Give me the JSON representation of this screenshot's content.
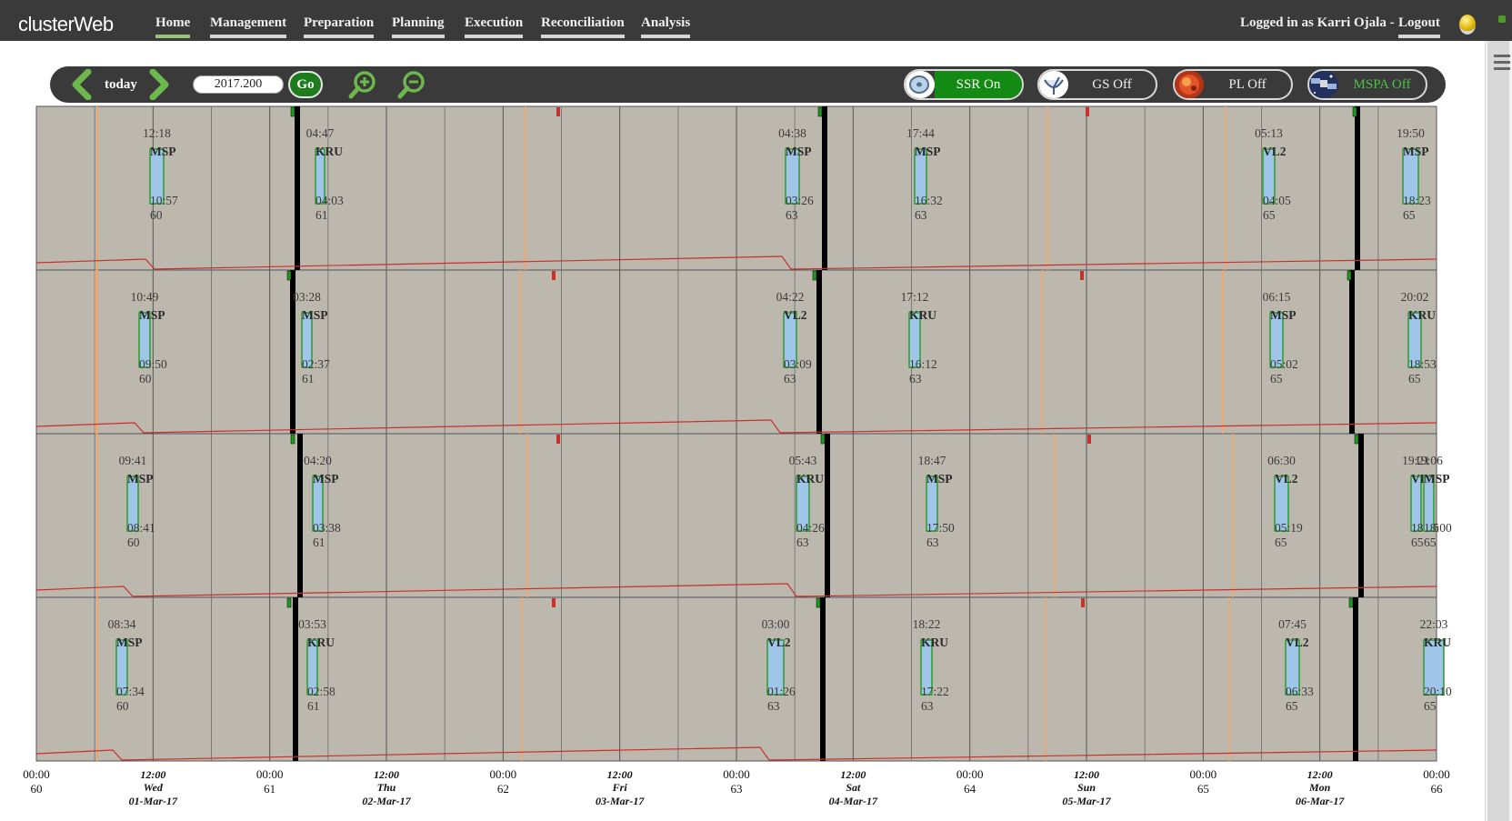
{
  "app": {
    "logo": "clusterWeb"
  },
  "nav": {
    "items": [
      {
        "label": "Home",
        "active": true
      },
      {
        "label": "Management"
      },
      {
        "label": "Preparation"
      },
      {
        "label": "Planning"
      },
      {
        "label": "Execution"
      },
      {
        "label": "Reconciliation"
      },
      {
        "label": "Analysis"
      }
    ],
    "user_label": "Logged in as Karri Ojala -",
    "logout_label": "Logout"
  },
  "toolbar": {
    "today_label": "today",
    "date_value": "2017.200",
    "go_label": "Go",
    "toggles": [
      {
        "label": "SSR On",
        "state": "on",
        "icon": "ssr-disk-icon"
      },
      {
        "label": "GS Off",
        "state": "off",
        "icon": "ground-station-dish-icon"
      },
      {
        "label": "PL Off",
        "state": "off",
        "icon": "payload-sun-icon"
      },
      {
        "label": "MSPA Off",
        "state": "off",
        "icon": "mspa-satellite-icon"
      }
    ]
  },
  "colors": {
    "nav_bg": "#3a3a3a",
    "plot_bg": "#bcb8ae",
    "pass_fill": "#9fc5e8",
    "pass_border": "#2e9a2e",
    "orange_marker": "#f2a56b",
    "red_curve": "#c9302c",
    "accent_green": "#138a13"
  },
  "axis": {
    "ticks": [
      {
        "time": "00:00",
        "sub": "60",
        "bold": false
      },
      {
        "time": "12:00",
        "day": "Wed",
        "date": "01-Mar-17",
        "bold": true
      },
      {
        "time": "00:00",
        "sub": "61",
        "bold": false
      },
      {
        "time": "12:00",
        "day": "Thu",
        "date": "02-Mar-17",
        "bold": true
      },
      {
        "time": "00:00",
        "sub": "62",
        "bold": false
      },
      {
        "time": "12:00",
        "day": "Fri",
        "date": "03-Mar-17",
        "bold": true
      },
      {
        "time": "00:00",
        "sub": "63",
        "bold": false
      },
      {
        "time": "12:00",
        "day": "Sat",
        "date": "04-Mar-17",
        "bold": true
      },
      {
        "time": "00:00",
        "sub": "64",
        "bold": false
      },
      {
        "time": "12:00",
        "day": "Sun",
        "date": "05-Mar-17",
        "bold": true
      },
      {
        "time": "00:00",
        "sub": "65",
        "bold": false
      },
      {
        "time": "12:00",
        "day": "Mon",
        "date": "06-Mar-17",
        "bold": true
      },
      {
        "time": "00:00",
        "sub": "66",
        "bold": false
      }
    ]
  },
  "rows": [
    {
      "passes": [
        {
          "start": "12:18",
          "station": "MSP",
          "end": "10:57",
          "orbit": "60"
        },
        {
          "start": "04:47",
          "station": "KRU",
          "end": "04:03",
          "orbit": "61"
        },
        {
          "start": "04:38",
          "station": "MSP",
          "end": "03:26",
          "orbit": "63"
        },
        {
          "start": "17:44",
          "station": "MSP",
          "end": "16:32",
          "orbit": "63"
        },
        {
          "start": "05:13",
          "station": "VL2",
          "end": "04:05",
          "orbit": "65"
        },
        {
          "start": "19:50",
          "station": "MSP",
          "end": "18:23",
          "orbit": "65"
        }
      ]
    },
    {
      "passes": [
        {
          "start": "10:49",
          "station": "MSP",
          "end": "09:50",
          "orbit": "60"
        },
        {
          "start": "03:28",
          "station": "MSP",
          "end": "02:37",
          "orbit": "61"
        },
        {
          "start": "04:22",
          "station": "VL2",
          "end": "03:09",
          "orbit": "63"
        },
        {
          "start": "17:12",
          "station": "KRU",
          "end": "16:12",
          "orbit": "63"
        },
        {
          "start": "06:15",
          "station": "MSP",
          "end": "05:02",
          "orbit": "65"
        },
        {
          "start": "20:02",
          "station": "KRU",
          "end": "18:53",
          "orbit": "65"
        }
      ]
    },
    {
      "passes": [
        {
          "start": "09:41",
          "station": "MSP",
          "end": "08:41",
          "orbit": "60"
        },
        {
          "start": "04:20",
          "station": "MSP",
          "end": "03:38",
          "orbit": "61"
        },
        {
          "start": "05:43",
          "station": "KRU",
          "end": "04:26",
          "orbit": "63"
        },
        {
          "start": "18:47",
          "station": "MSP",
          "end": "17:50",
          "orbit": "63"
        },
        {
          "start": "06:30",
          "station": "VL2",
          "end": "05:19",
          "orbit": "65"
        },
        {
          "start": "19:21",
          "station": "VL2",
          "end": "18:05",
          "orbit": "65"
        },
        {
          "start": "19:06",
          "station": "MSP",
          "end": "18:00",
          "orbit": "65"
        }
      ]
    },
    {
      "passes": [
        {
          "start": "08:34",
          "station": "MSP",
          "end": "07:34",
          "orbit": "60"
        },
        {
          "start": "03:53",
          "station": "KRU",
          "end": "02:58",
          "orbit": "61"
        },
        {
          "start": "03:00",
          "station": "VL2",
          "end": "01:26",
          "orbit": "63"
        },
        {
          "start": "18:22",
          "station": "KRU",
          "end": "17:22",
          "orbit": "63"
        },
        {
          "start": "07:45",
          "station": "VL2",
          "end": "06:33",
          "orbit": "65"
        },
        {
          "start": "22:03",
          "station": "KRU",
          "end": "20:10",
          "orbit": "65"
        }
      ]
    }
  ]
}
